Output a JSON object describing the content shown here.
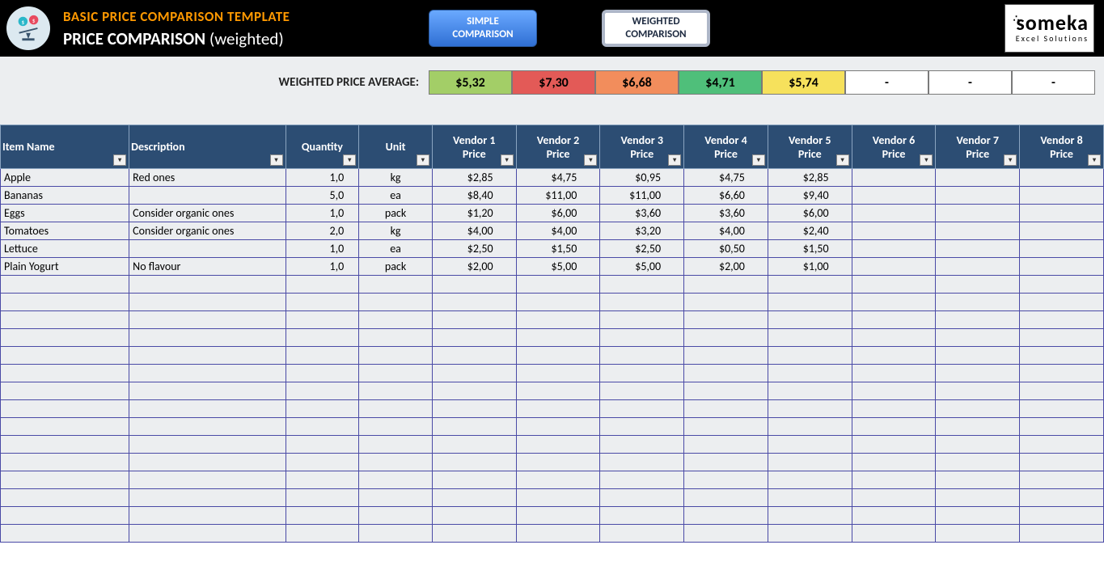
{
  "header": {
    "template_title": "BASIC PRICE COMPARISON TEMPLATE",
    "page_title_main": "PRICE COMPARISON",
    "page_title_sub": "(weighted)",
    "tab_simple_l1": "SIMPLE",
    "tab_simple_l2": "COMPARISON",
    "tab_weighted_l1": "WEIGHTED",
    "tab_weighted_l2": "COMPARISON",
    "brand_name": "someka",
    "brand_tag": "Excel Solutions"
  },
  "avg": {
    "label": "WEIGHTED PRICE AVERAGE:",
    "cells": [
      {
        "v": "$5,32",
        "bg": "#a3ce67"
      },
      {
        "v": "$7,30",
        "bg": "#e35a57"
      },
      {
        "v": "$6,68",
        "bg": "#f28d5c"
      },
      {
        "v": "$4,71",
        "bg": "#4fbf7a"
      },
      {
        "v": "$5,74",
        "bg": "#f6e15c"
      },
      {
        "v": "-",
        "bg": "#ffffff"
      },
      {
        "v": "-",
        "bg": "#ffffff"
      },
      {
        "v": "-",
        "bg": "#ffffff"
      }
    ]
  },
  "columns": {
    "name": "Item Name",
    "desc": "Description",
    "qty": "Quantity",
    "unit": "Unit",
    "vendors": [
      "Vendor 1 Price",
      "Vendor 2 Price",
      "Vendor 3 Price",
      "Vendor 4 Price",
      "Vendor 5 Price",
      "Vendor 6 Price",
      "Vendor 7 Price",
      "Vendor 8 Price"
    ]
  },
  "rows": [
    {
      "name": "Apple",
      "desc": "Red ones",
      "qty": "1,0",
      "unit": "kg",
      "p": [
        "$2,85",
        "$4,75",
        "$0,95",
        "$4,75",
        "$2,85",
        "",
        "",
        ""
      ]
    },
    {
      "name": "Bananas",
      "desc": "",
      "qty": "5,0",
      "unit": "ea",
      "p": [
        "$8,40",
        "$11,00",
        "$11,00",
        "$6,60",
        "$9,40",
        "",
        "",
        ""
      ]
    },
    {
      "name": "Eggs",
      "desc": "Consider organic ones",
      "qty": "1,0",
      "unit": "pack",
      "p": [
        "$1,20",
        "$6,00",
        "$3,60",
        "$3,60",
        "$6,00",
        "",
        "",
        ""
      ]
    },
    {
      "name": "Tomatoes",
      "desc": "Consider organic ones",
      "qty": "2,0",
      "unit": "kg",
      "p": [
        "$4,00",
        "$4,00",
        "$3,20",
        "$4,00",
        "$2,40",
        "",
        "",
        ""
      ]
    },
    {
      "name": "Lettuce",
      "desc": "",
      "qty": "1,0",
      "unit": "ea",
      "p": [
        "$2,50",
        "$1,50",
        "$2,50",
        "$0,50",
        "$1,50",
        "",
        "",
        ""
      ]
    },
    {
      "name": "Plain Yogurt",
      "desc": "No flavour",
      "qty": "1,0",
      "unit": "pack",
      "p": [
        "$2,00",
        "$5,00",
        "$5,00",
        "$2,00",
        "$1,00",
        "",
        "",
        ""
      ]
    }
  ],
  "empty_rows": 15
}
